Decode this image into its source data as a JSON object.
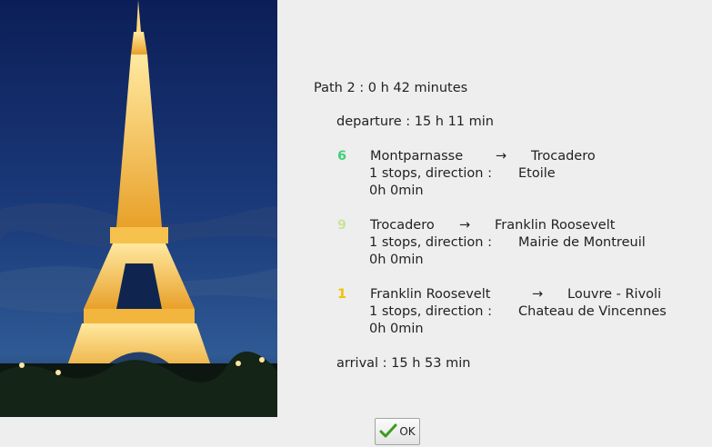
{
  "dialog": {
    "path_title": "Path 2 : 0 h 42 minutes",
    "departure": "departure : 15 h 11 min",
    "legs": [
      {
        "line": "6",
        "line_color": "#3ed07c",
        "from": "Montparnasse",
        "arrow": "→",
        "to": "Trocadero",
        "stops": "1 stops,  direction  :",
        "direction": "Etoile",
        "duration": "0h 0min"
      },
      {
        "line": "9",
        "line_color": "#c9e59a",
        "from": "Trocadero",
        "arrow": "→",
        "to": "Franklin Roosevelt",
        "stops": "1 stops,  direction  :",
        "direction": "Mairie de Montreuil",
        "duration": "0h 0min"
      },
      {
        "line": "1",
        "line_color": "#f2c200",
        "from": "Franklin Roosevelt",
        "arrow": "→",
        "to": "Louvre - Rivoli",
        "stops": "1 stops,  direction  :",
        "direction": "Chateau de Vincennes",
        "duration": "0h 0min"
      }
    ],
    "arrival": "arrival : 15 h 53 min",
    "ok_label": "OK",
    "ok_icon": "checkmark-icon"
  }
}
